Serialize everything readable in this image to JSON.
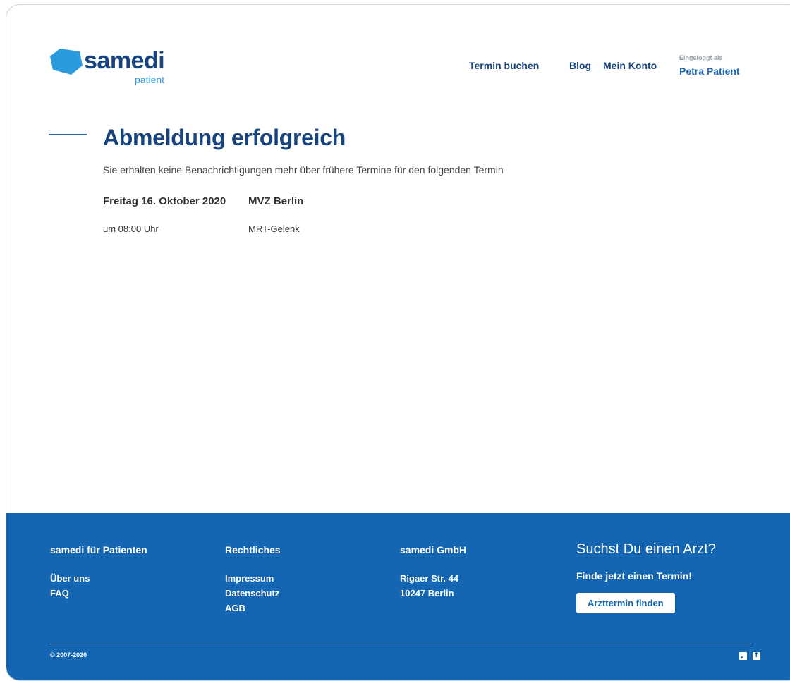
{
  "brand": {
    "name": "samedi",
    "sub": "patient"
  },
  "nav": {
    "termin": "Termin buchen",
    "blog": "Blog",
    "konto": "Mein Konto",
    "login_label": "Eingeloggt als",
    "login_name": "Petra Patient"
  },
  "main": {
    "title": "Abmeldung erfolgreich",
    "subtitle": "Sie erhalten keine Benachrichtigungen mehr über frühere Termine für den folgenden Termin",
    "appointment": {
      "date": "Freitag 16. Oktober 2020",
      "place": "MVZ Berlin",
      "time": "um 08:00 Uhr",
      "type": "MRT-Gelenk"
    }
  },
  "footer": {
    "col1": {
      "title": "samedi für Patienten",
      "links": [
        "Über uns",
        "FAQ"
      ]
    },
    "col2": {
      "title": "Rechtliches",
      "links": [
        "Impressum",
        "Datenschutz",
        "AGB"
      ]
    },
    "col3": {
      "title": "samedi GmbH",
      "lines": [
        "Rigaer Str. 44",
        "10247 Berlin"
      ]
    },
    "cta": {
      "heading": "Suchst Du einen Arzt?",
      "sub": "Finde jetzt einen Termin!",
      "button": "Arzttermin finden"
    },
    "copyright": "© 2007-2020",
    "icons": [
      "rss-icon",
      "facebook-icon"
    ]
  },
  "colors": {
    "brand_dark": "#17447f",
    "brand_light": "#2b9be0",
    "footer_bg": "#1466b2"
  }
}
